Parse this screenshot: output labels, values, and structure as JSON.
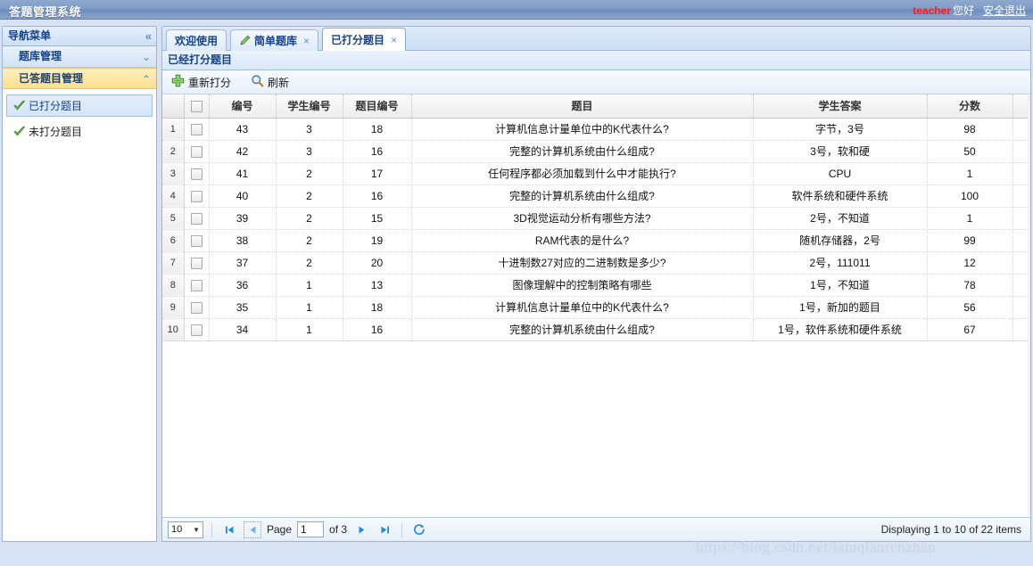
{
  "header": {
    "title": "答题管理系统",
    "username": "teacher",
    "hello": "您好",
    "logout": "安全退出"
  },
  "sidebar": {
    "title": "导航菜单",
    "collapse_icon": "double-chevron-left-icon",
    "groups": [
      {
        "label": "题库管理",
        "state": "collapsed",
        "icon": "chevron-down-icon"
      },
      {
        "label": "已答题目管理",
        "state": "expanded",
        "icon": "chevron-up-icon"
      }
    ],
    "items": [
      {
        "label": "已打分题目",
        "icon": "green-check-icon",
        "active": true
      },
      {
        "label": "未打分题目",
        "icon": "green-check-icon",
        "active": false
      }
    ]
  },
  "tabs": [
    {
      "label": "欢迎使用",
      "closable": false,
      "icon": null,
      "active": false
    },
    {
      "label": "简单题库",
      "closable": true,
      "icon": "pencil-icon",
      "active": false
    },
    {
      "label": "已打分题目",
      "closable": true,
      "icon": null,
      "active": true
    }
  ],
  "panel": {
    "title": "已经打分题目",
    "toolbar": [
      {
        "label": "重新打分",
        "icon": "green-plus-icon"
      },
      {
        "label": "刷新",
        "icon": "magnifier-icon"
      }
    ]
  },
  "grid": {
    "columns": [
      "编号",
      "学生编号",
      "题目编号",
      "题目",
      "学生答案",
      "分数"
    ],
    "rows": [
      {
        "n": "1",
        "id": "43",
        "student": "3",
        "qid": "18",
        "question": "计算机信息计量单位中的K代表什么?",
        "answer": "字节，3号",
        "score": "98"
      },
      {
        "n": "2",
        "id": "42",
        "student": "3",
        "qid": "16",
        "question": "完整的计算机系统由什么组成?",
        "answer": "3号，软和硬",
        "score": "50"
      },
      {
        "n": "3",
        "id": "41",
        "student": "2",
        "qid": "17",
        "question": "任何程序都必须加载到什么中才能执行?",
        "answer": "CPU",
        "score": "1"
      },
      {
        "n": "4",
        "id": "40",
        "student": "2",
        "qid": "16",
        "question": "完整的计算机系统由什么组成?",
        "answer": "软件系统和硬件系统",
        "score": "100"
      },
      {
        "n": "5",
        "id": "39",
        "student": "2",
        "qid": "15",
        "question": "3D视觉运动分析有哪些方法?",
        "answer": "2号，不知道",
        "score": "1"
      },
      {
        "n": "6",
        "id": "38",
        "student": "2",
        "qid": "19",
        "question": "RAM代表的是什么?",
        "answer": "随机存储器，2号",
        "score": "99"
      },
      {
        "n": "7",
        "id": "37",
        "student": "2",
        "qid": "20",
        "question": "十进制数27对应的二进制数是多少?",
        "answer": "2号，111011",
        "score": "12"
      },
      {
        "n": "8",
        "id": "36",
        "student": "1",
        "qid": "13",
        "question": "图像理解中的控制策略有哪些",
        "answer": "1号，不知道",
        "score": "78"
      },
      {
        "n": "9",
        "id": "35",
        "student": "1",
        "qid": "18",
        "question": "计算机信息计量单位中的K代表什么?",
        "answer": "1号，新加的题目",
        "score": "56"
      },
      {
        "n": "10",
        "id": "34",
        "student": "1",
        "qid": "16",
        "question": "完整的计算机系统由什么组成?",
        "answer": "1号，软件系统和硬件系统",
        "score": "67"
      }
    ]
  },
  "pager": {
    "page_size": "10",
    "page_label": "Page",
    "page_value": "1",
    "of_label": "of 3",
    "status": "Displaying 1 to 10 of 22 items",
    "buttons": [
      "first-page-icon",
      "prev-page-icon",
      "next-page-icon",
      "last-page-icon",
      "refresh-icon"
    ]
  },
  "watermark": "https://blog.csdn.net/iamqianrenzhan",
  "colors": {
    "header_blue": "#7e9bc6",
    "accent_blue": "#15428b",
    "highlight_gold": "#fbe08a",
    "username_red": "#ff1a1a",
    "pager_blue": "#1f8ae0"
  }
}
